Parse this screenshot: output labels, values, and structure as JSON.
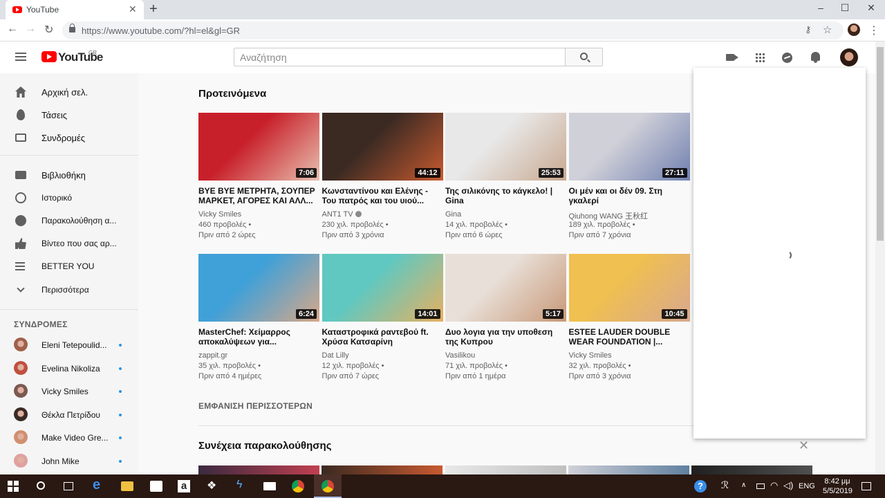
{
  "browser": {
    "tab_title": "YouTube",
    "tab_close": "✕",
    "new_tab": "+",
    "url": "https://www.youtube.com/?hl=el&gl=GR",
    "window_controls": [
      "–",
      "☐",
      "✕"
    ]
  },
  "masthead": {
    "logo_text": "YouTube",
    "country_code": "GR",
    "search_placeholder": "Αναζήτηση"
  },
  "sidebar": {
    "primary": [
      {
        "label": "Αρχική σελ.",
        "icon": "home-icon"
      },
      {
        "label": "Τάσεις",
        "icon": "flame-icon"
      },
      {
        "label": "Συνδρομές",
        "icon": "subscriptions-icon"
      }
    ],
    "library": [
      {
        "label": "Βιβλιοθήκη",
        "icon": "library-icon"
      },
      {
        "label": "Ιστορικό",
        "icon": "history-icon"
      },
      {
        "label": "Παρακολούθηση α...",
        "icon": "watch-later-icon"
      },
      {
        "label": "Βίντεο που σας αρ...",
        "icon": "liked-videos-icon"
      },
      {
        "label": "BETTER YOU",
        "icon": "playlist-icon"
      },
      {
        "label": "Περισσότερα",
        "icon": "chevron-down-icon"
      }
    ],
    "subscriptions_heading": "ΣΥΝΔΡΟΜΕΣ",
    "subscriptions": [
      {
        "name": "Eleni Tetepoulid...",
        "color": "#a0604a"
      },
      {
        "name": "Evelina Nikoliza",
        "color": "#c05040"
      },
      {
        "name": "Vicky Smiles",
        "color": "#7a5a50"
      },
      {
        "name": "Θέκλα Πετρίδου",
        "color": "#3a2a24"
      },
      {
        "name": "Make Video Gre...",
        "color": "#d09070"
      },
      {
        "name": "John Mike",
        "color": "#e0a0a0"
      }
    ]
  },
  "main": {
    "recommended_title": "Προτεινόμενα",
    "videos": [
      {
        "title": "BYE BYE ΜΕΤΡΗΤΑ, ΣΟΥΠΕΡ ΜΑΡΚΕΤ, ΑΓΟΡΕΣ ΚΑΙ ΑΛΛ...",
        "channel": "Vicky Smiles",
        "verified": false,
        "views": "460 προβολές",
        "age": "Πριν από 2 ώρες",
        "duration": "7:06",
        "c1": "#c8202a",
        "c2": "#e8c0b0"
      },
      {
        "title": "Κωνσταντίνου και Ελένης - Του πατρός και του υιού...",
        "channel": "ANT1 TV",
        "verified": true,
        "views": "230 χιλ. προβολές",
        "age": "Πριν από 3 χρόνια",
        "duration": "44:12",
        "c1": "#3a2a22",
        "c2": "#c85a30"
      },
      {
        "title": "Της σιλικόνης το κάγκελο! | Gina",
        "channel": "Gina",
        "verified": false,
        "views": "14 χιλ. προβολές",
        "age": "Πριν από 6 ώρες",
        "duration": "25:53",
        "c1": "#e8e8e8",
        "c2": "#c8a890"
      },
      {
        "title": "Οι μέν και οι δέν 09. Στη γκαλερί",
        "channel": "Qiuhong WANG 王秋红",
        "verified": false,
        "views": "189 χιλ. προβολές",
        "age": "Πριν από 7 χρόνια",
        "duration": "27:11",
        "c1": "#d0d0d8",
        "c2": "#7080b0"
      },
      {
        "title": "MasterChef: Χείμαρρος αποκαλύψεων για...",
        "channel": "zappit.gr",
        "verified": false,
        "views": "35 χιλ. προβολές",
        "age": "Πριν από 4 ημέρες",
        "duration": "6:24",
        "c1": "#40a0d8",
        "c2": "#d8a888"
      },
      {
        "title": "Καταστροφικά ραντεβού ft. Χρύσα Κατσαρίνη",
        "channel": "Dat Lilly",
        "verified": false,
        "views": "12 χιλ. προβολές",
        "age": "Πριν από 7 ώρες",
        "duration": "14:01",
        "c1": "#60c8c0",
        "c2": "#e8b060"
      },
      {
        "title": "Δυο λογια για την υποθεση της Κυπρου",
        "channel": "Vasilikou",
        "verified": false,
        "views": "71 χιλ. προβολές",
        "age": "Πριν από 1 ημέρα",
        "duration": "5:17",
        "c1": "#e8e0d8",
        "c2": "#c89878"
      },
      {
        "title": "ESTEE LAUDER DOUBLE WEAR FOUNDATION |...",
        "channel": "Vicky Smiles",
        "verified": false,
        "views": "32 χιλ. προβολές",
        "age": "Πριν από 3 χρόνια",
        "duration": "10:45",
        "c1": "#f0c050",
        "c2": "#d8a890"
      }
    ],
    "show_more": "ΕΜΦΑΝΙΣΗ ΠΕΡΙΣΣΟΤΕΡΩΝ",
    "continue_title": "Συνέχεια παρακολούθησης",
    "dismiss": "✕"
  },
  "taskbar": {
    "lang": "ENG",
    "time": "8:42 μμ",
    "date": "5/5/2019"
  }
}
